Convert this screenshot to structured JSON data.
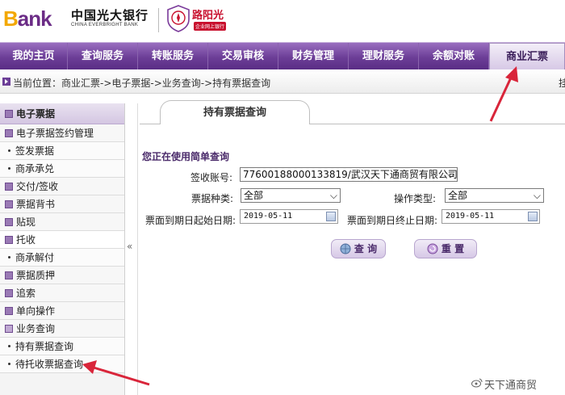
{
  "header": {
    "logo_text": "Bank",
    "logo_b": "B",
    "logo_rest": "ank",
    "bank_name_cn": "中国光大银行",
    "bank_name_en": "CHINA EVERBRIGHT BANK",
    "brand_name": "阳光",
    "brand_prefix": "路",
    "brand_sub": "企业网上银行"
  },
  "nav": {
    "items": [
      {
        "label": "我的主页"
      },
      {
        "label": "查询服务"
      },
      {
        "label": "转账服务"
      },
      {
        "label": "交易审核"
      },
      {
        "label": "财务管理"
      },
      {
        "label": "理财服务"
      },
      {
        "label": "余额对账"
      },
      {
        "label": "商业汇票",
        "active": true
      }
    ]
  },
  "breadcrumb": {
    "text": "当前位置：商业汇票->电子票据->业务查询->持有票据查询",
    "edge_char": "挂"
  },
  "sidebar": {
    "header": "电子票据",
    "items": [
      {
        "label": "电子票据签约管理",
        "kind": "group"
      },
      {
        "label": "签发票据",
        "kind": "sub"
      },
      {
        "label": "商承承兑",
        "kind": "sub"
      },
      {
        "label": "交付/签收",
        "kind": "group"
      },
      {
        "label": "票据背书",
        "kind": "group"
      },
      {
        "label": "贴现",
        "kind": "group"
      },
      {
        "label": "托收",
        "kind": "group",
        "active": true
      },
      {
        "label": "商承解付",
        "kind": "sub"
      },
      {
        "label": "票据质押",
        "kind": "group"
      },
      {
        "label": "追索",
        "kind": "group"
      },
      {
        "label": "单向操作",
        "kind": "group"
      },
      {
        "label": "业务查询",
        "kind": "group",
        "open": true
      },
      {
        "label": "持有票据查询",
        "kind": "sub"
      },
      {
        "label": "待托收票据查询",
        "kind": "sub"
      }
    ],
    "collapse_glyph": "«"
  },
  "content": {
    "tab_title": "持有票据查询",
    "subtitle": "您正在使用简单查询",
    "form": {
      "account_label": "签收账号:",
      "account_value": "77600188000133819/武汉天下通商贸有限公司",
      "bill_type_label": "票据种类:",
      "bill_type_value": "全部",
      "op_type_label": "操作类型:",
      "op_type_value": "全部",
      "start_date_label": "票面到期日起始日期:",
      "start_date_value": "2019-05-11",
      "end_date_label": "票面到期日终止日期:",
      "end_date_value": "2019-05-11",
      "select_arrow": "⌵"
    },
    "buttons": {
      "query_label": "查 询",
      "reset_label": "重 置"
    }
  },
  "watermark": {
    "text": "天下通商贸"
  },
  "colors": {
    "nav_purple": "#6c3e97",
    "brand_red": "#c8102e",
    "accent_arrow": "#d9253a"
  }
}
